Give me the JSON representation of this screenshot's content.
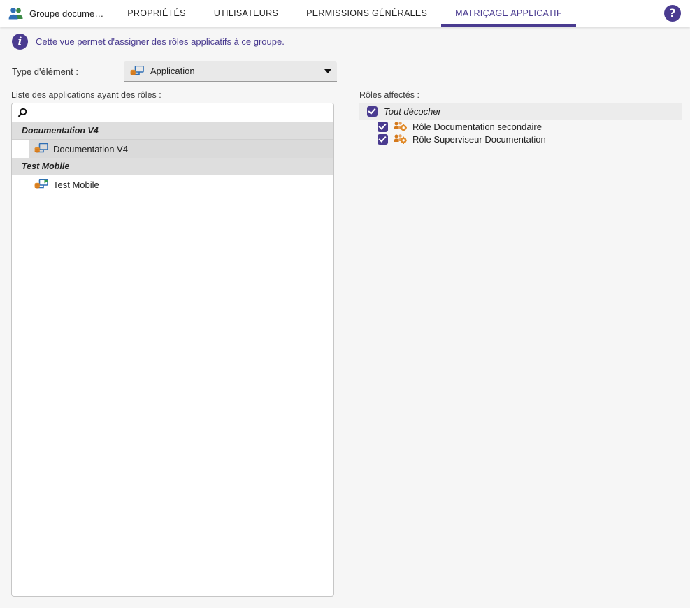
{
  "header": {
    "group_icon": "group-people-icon",
    "title": "Groupe docume…",
    "tabs": [
      {
        "label": "PROPRIÉTÉS",
        "active": false
      },
      {
        "label": "UTILISATEURS",
        "active": false
      },
      {
        "label": "PERMISSIONS GÉNÉRALES",
        "active": false
      },
      {
        "label": "MATRIÇAGE APPLICATIF",
        "active": true
      }
    ],
    "help_icon": "help-circle-icon",
    "accent_color": "#4a3b90"
  },
  "info": {
    "icon": "info-circle-icon",
    "message": "Cette vue permet d'assigner des rôles applicatifs à ce groupe."
  },
  "type_row": {
    "label": "Type d'élément :",
    "select": {
      "icon": "application-icon",
      "value": "Application",
      "caret_icon": "chevron-down-icon"
    }
  },
  "left_panel": {
    "label": "Liste des applications ayant des rôles :",
    "search": {
      "icon": "search-icon",
      "value": "",
      "placeholder": ""
    },
    "groups": [
      {
        "name": "Documentation V4",
        "items": [
          {
            "label": "Documentation V4",
            "icon": "application-icon",
            "selected": true
          }
        ]
      },
      {
        "name": "Test Mobile",
        "items": [
          {
            "label": "Test Mobile",
            "icon": "application-mobile-icon",
            "selected": false
          }
        ]
      }
    ]
  },
  "right_panel": {
    "label": "Rôles affectés :",
    "select_all": {
      "label": "Tout décocher",
      "checked": true
    },
    "roles": [
      {
        "label": "Rôle Documentation secondaire",
        "icon": "role-group-icon",
        "checked": true
      },
      {
        "label": "Rôle Superviseur Documentation",
        "icon": "role-group-icon",
        "checked": true
      }
    ]
  }
}
